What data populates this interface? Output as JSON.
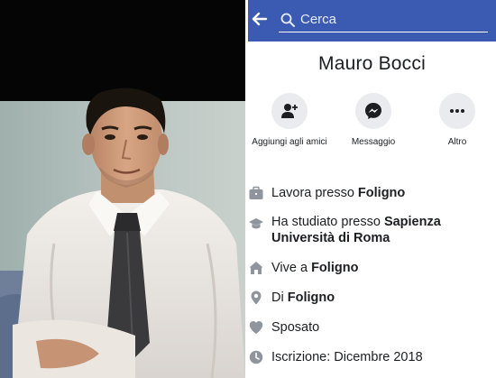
{
  "search": {
    "placeholder": "Cerca"
  },
  "profile": {
    "name": "Mauro Bocci"
  },
  "actions": [
    {
      "label": "Aggiungi agli amici",
      "icon": "add-friend-icon"
    },
    {
      "label": "Messaggio",
      "icon": "messenger-icon"
    },
    {
      "label": "Altro",
      "icon": "more-dots-icon"
    }
  ],
  "info": [
    {
      "icon": "briefcase-icon",
      "prefix": "Lavora presso ",
      "value": "Foligno"
    },
    {
      "icon": "graduation-cap-icon",
      "prefix": "Ha studiato presso ",
      "value": "Sapienza Università di Roma"
    },
    {
      "icon": "home-icon",
      "prefix": "Vive a ",
      "value": "Foligno"
    },
    {
      "icon": "location-pin-icon",
      "prefix": "Di ",
      "value": "Foligno"
    },
    {
      "icon": "heart-icon",
      "prefix": "Sposato",
      "value": ""
    },
    {
      "icon": "clock-icon",
      "prefix": "Iscrizione: Dicembre 2018",
      "value": ""
    }
  ],
  "colors": {
    "header": "#3b5bb3",
    "action_bg": "#e9ebee",
    "icon_gray": "#90949c"
  }
}
